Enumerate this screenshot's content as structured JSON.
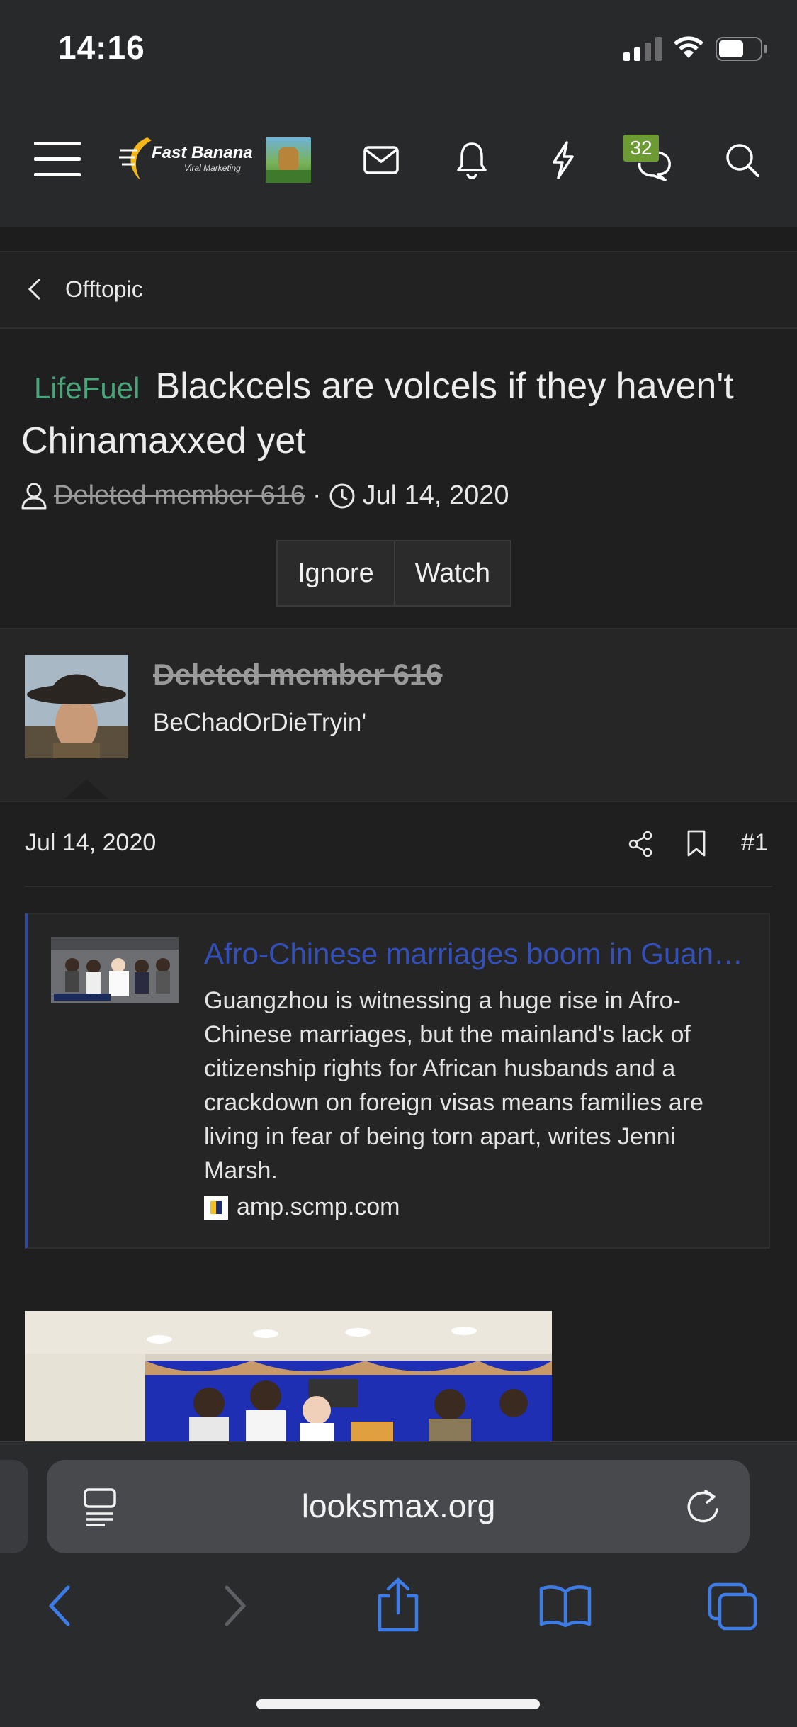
{
  "status_bar": {
    "time": "14:16"
  },
  "header": {
    "logo_text": "Fast Banana",
    "logo_subtext": "Viral Marketing",
    "badge_count": "32"
  },
  "breadcrumb": {
    "label": "Offtopic"
  },
  "thread": {
    "prefix": "LifeFuel",
    "title": "Blackcels are volcels if they haven't Chinamaxxed yet",
    "author": "Deleted member 616",
    "date": "Jul 14, 2020",
    "ignore_label": "Ignore",
    "watch_label": "Watch"
  },
  "post": {
    "username": "Deleted member 616",
    "user_title": "BeChadOrDieTryin'",
    "date": "Jul 14, 2020",
    "number": "#1",
    "embed": {
      "title": "Afro-Chinese marriages boom in Guangzhou",
      "description": "Guangzhou is witnessing a huge rise in Afro-Chinese marriages, but the mainland's lack of citizenship rights for African husbands and a crackdown on foreign visas means families are living in fear of being torn apart, writes Jenni Marsh.",
      "site": "amp.scmp.com"
    }
  },
  "browser": {
    "url": "looksmax.org"
  },
  "colors": {
    "prefix_green": "#4aa67a",
    "link_blue": "#3450b8",
    "ios_blue": "#3d7be6",
    "badge_green": "#6c9b33"
  }
}
